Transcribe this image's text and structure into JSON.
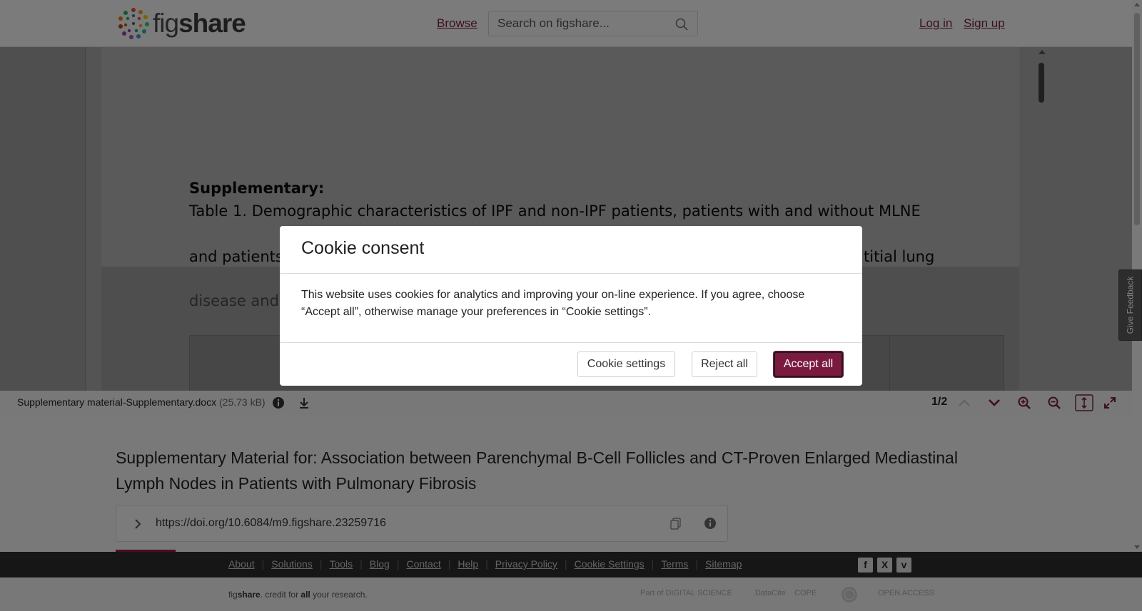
{
  "header": {
    "logo_text_light": "fig",
    "logo_text_bold": "share",
    "browse": "Browse",
    "search_placeholder": "Search on figshare...",
    "login": "Log in",
    "signup": "Sign up"
  },
  "document": {
    "heading": "Supplementary:",
    "line1": "Table 1. Demographic characteristics of IPF and non-IPF patients, patients with and without MLNE",
    "line2": "and patients",
    "line2_end": "titial lung",
    "line3": "disease and"
  },
  "viewer_toolbar": {
    "file_name": "Supplementary material-Supplementary.docx",
    "file_size": "(25.73 kB)",
    "page_count": "1/2"
  },
  "item": {
    "title": "Supplementary Material for: Association between Parenchymal B-Cell Follicles and CT-Proven Enlarged Mediastinal Lymph Nodes in Patients with Pulmonary Fibrosis",
    "doi": "https://doi.org/10.6084/m9.figshare.23259716"
  },
  "feedback": {
    "label": "Give Feedback"
  },
  "footer": {
    "links": [
      "About",
      "Solutions",
      "Tools",
      "Blog",
      "Contact",
      "Help",
      "Privacy Policy",
      "Cookie Settings",
      "Terms",
      "Sitemap"
    ],
    "tagline_1": "fig",
    "tagline_2": "share",
    "tagline_3": ". credit for ",
    "tagline_4": "all",
    "tagline_5": " your research.",
    "partners": [
      "Part of DIGITAL SCIENCE",
      "DataCite",
      "COPE",
      "",
      "OPEN ACCESS"
    ],
    "social": [
      "f",
      "X",
      "v"
    ]
  },
  "cookie_modal": {
    "title": "Cookie consent",
    "body": "This website uses cookies for analytics and improving your on-line experience. If you agree, choose “Accept all”, otherwise manage your preferences in “Cookie settings”.",
    "settings_button": "Cookie settings",
    "reject_button": "Reject all",
    "accept_button": "Accept all"
  },
  "colors": {
    "brand": "#7a1a3f",
    "footer_dark": "#2d2d2d"
  }
}
